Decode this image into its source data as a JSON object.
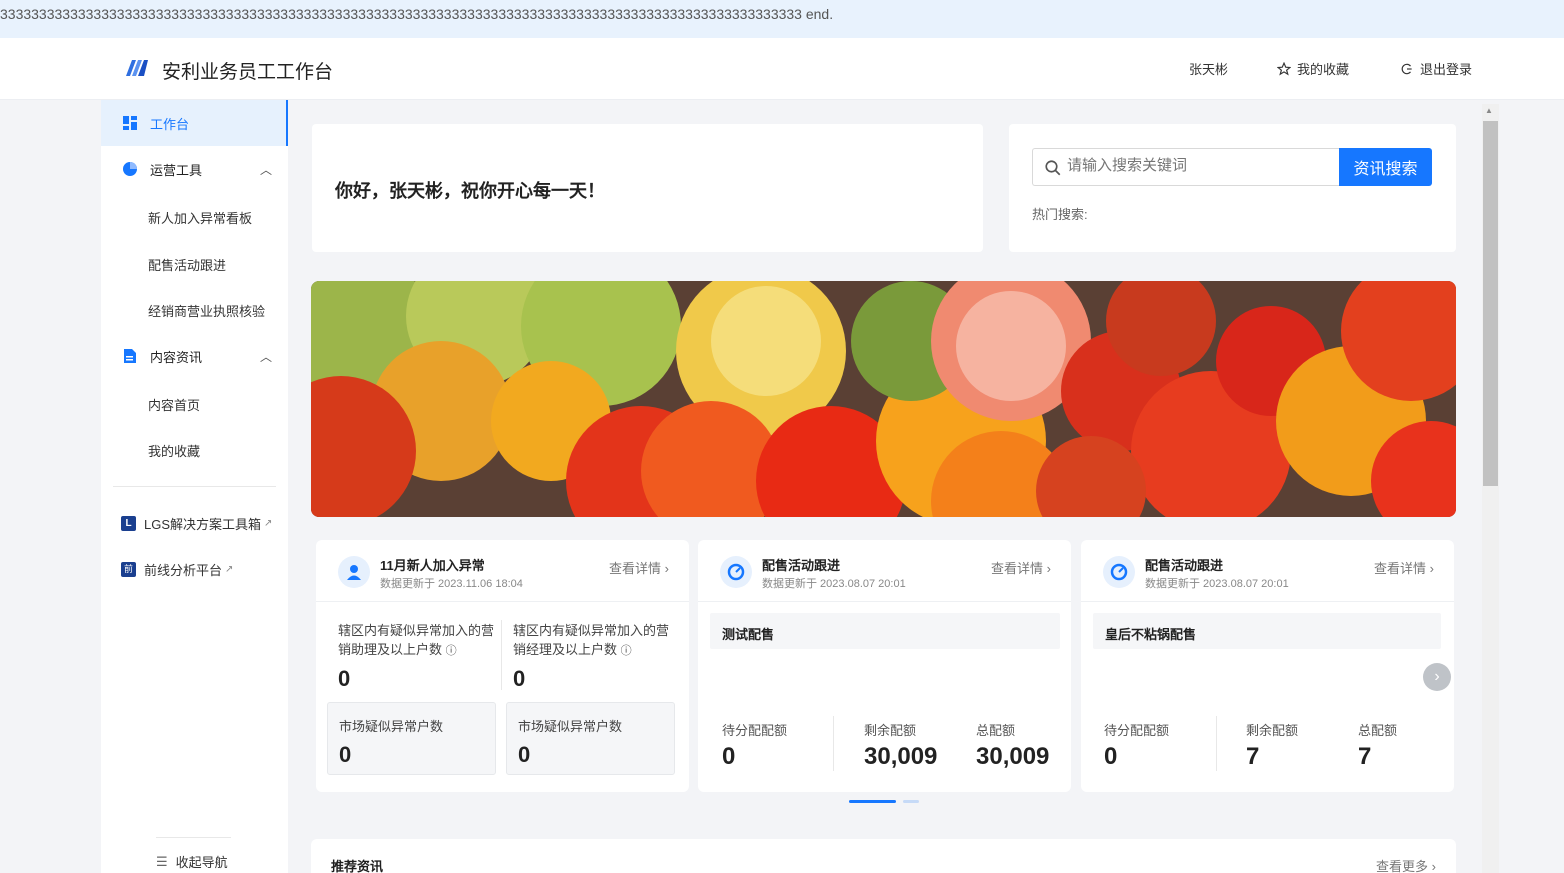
{
  "top_banner": {
    "text": "3333333333333333333333333333333333333333333333333333333333333333333333333333333333333333333333333333333 end."
  },
  "header": {
    "app_title": "安利业务员工工作台",
    "user_name": "张天彬",
    "favorites_label": "我的收藏",
    "logout_label": "退出登录"
  },
  "sidebar": {
    "workbench": "工作台",
    "ops_tools": "运营工具",
    "ops_items": [
      "新人加入异常看板",
      "配售活动跟进",
      "经销商营业执照核验"
    ],
    "content_news": "内容资讯",
    "content_items": [
      "内容首页",
      "我的收藏"
    ],
    "lgs": "LGS解决方案工具箱",
    "frontline": "前线分析平台",
    "collapse": "收起导航"
  },
  "greeting": {
    "text": "你好，张天彬，祝你开心每一天！"
  },
  "search": {
    "placeholder": "请输入搜索关键词",
    "button": "资讯搜索",
    "hot_label": "热门搜索:"
  },
  "cards": [
    {
      "title": "11月新人加入异常",
      "updated": "数据更新于 2023.11.06 18:04",
      "link": "查看详情",
      "stat1_label": "辖区内有疑似异常加入的营销助理及以上户数",
      "stat1_value": "0",
      "stat2_label": "辖区内有疑似异常加入的营销经理及以上户数",
      "stat2_value": "0",
      "mini1_label": "市场疑似异常户数",
      "mini1_value": "0",
      "mini2_label": "市场疑似异常户数",
      "mini2_value": "0"
    },
    {
      "title": "配售活动跟进",
      "updated": "数据更新于 2023.08.07 20:01",
      "link": "查看详情",
      "activity": "测试配售",
      "q1_label": "待分配配额",
      "q1_value": "0",
      "q2_label": "剩余配额",
      "q2_value": "30,009",
      "q3_label": "总配额",
      "q3_value": "30,009"
    },
    {
      "title": "配售活动跟进",
      "updated": "数据更新于 2023.08.07 20:01",
      "link": "查看详情",
      "activity": "皇后不粘锅配售",
      "q1_label": "待分配配额",
      "q1_value": "0",
      "q2_label": "剩余配额",
      "q2_value": "7",
      "q3_label": "总配额",
      "q3_value": "7"
    }
  ],
  "recommend": {
    "title": "推荐资讯",
    "more": "查看更多"
  },
  "colors": {
    "accent": "#1677ff",
    "active_bg": "#e6f1fd",
    "page_bg": "#f3f4f7"
  }
}
